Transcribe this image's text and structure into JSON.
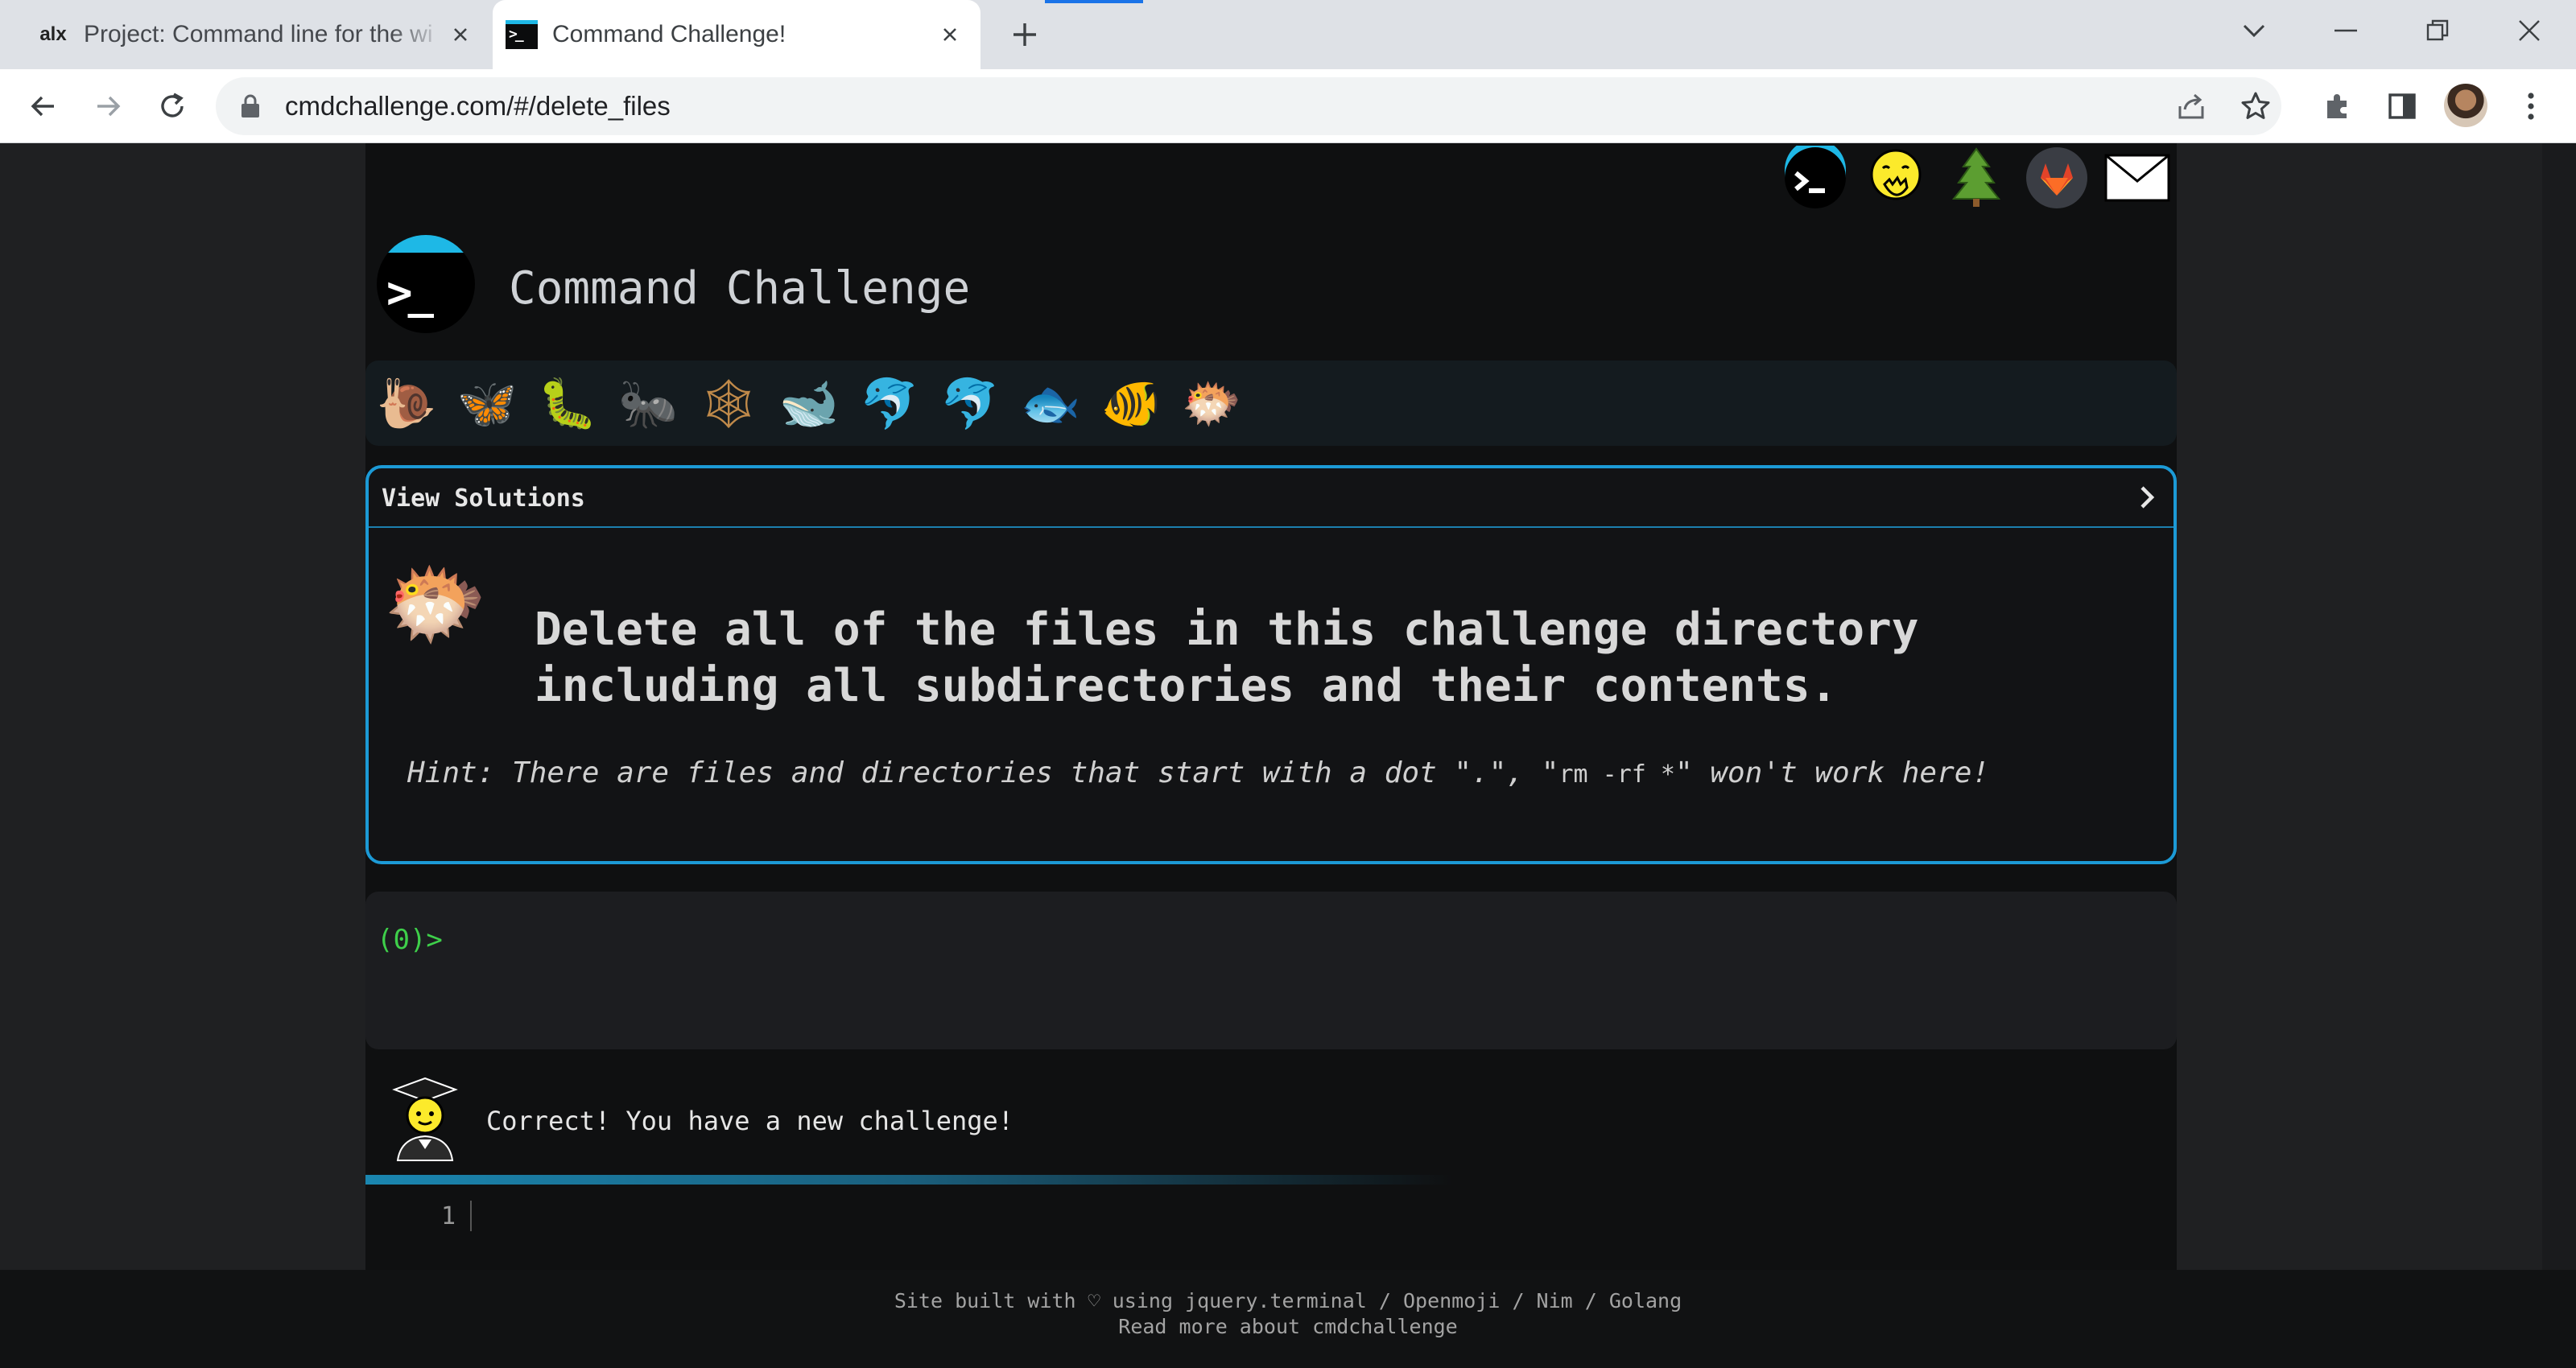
{
  "browser": {
    "tabs": [
      {
        "favicon_text": "alx",
        "title": "Project: Command line for the wi",
        "active": false
      },
      {
        "favicon_text": ">_",
        "title": "Command Challenge!",
        "active": true
      }
    ],
    "url": "cmdchallenge.com/#/delete_files"
  },
  "page": {
    "header_icons": [
      "terminal-logo",
      "face-hand-over-mouth",
      "tree",
      "gitlab",
      "envelope"
    ],
    "site_title": "Command Challenge",
    "levels": [
      "snail",
      "butterfly",
      "caterpillar",
      "ant",
      "spider-web",
      "whale",
      "dolphin",
      "dolphin",
      "fish",
      "tropical-fish",
      "blowfish"
    ],
    "solutions": {
      "label": "View Solutions"
    },
    "challenge": {
      "description": "Delete all of the files in this challenge directory including all subdirectories and their contents.",
      "hint_prefix": "Hint: There are files and directories that start with a dot \".\", \"",
      "hint_code": "rm -rf *",
      "hint_suffix": "\" won't work here!"
    },
    "terminal": {
      "prompt": "(0)>"
    },
    "feedback": {
      "message": "Correct! You have a new challenge!"
    },
    "editor": {
      "line_number": "1"
    },
    "footer": {
      "line1": "Site built with ♡ using jquery.terminal / Openmoji / Nim / Golang",
      "line2": "Read more about cmdchallenge"
    }
  },
  "colors": {
    "accent": "#1c9ad6",
    "prompt": "#3ecf4a",
    "page_bg": "#0f1011"
  }
}
